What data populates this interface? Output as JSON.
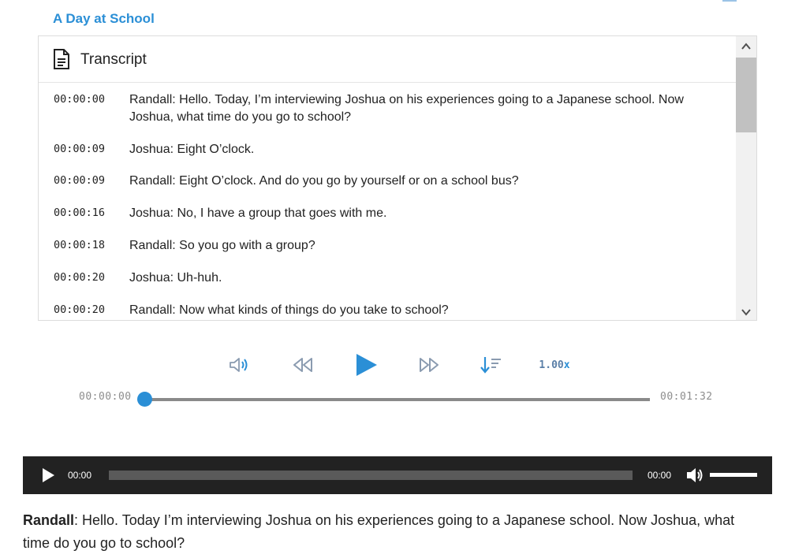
{
  "page": {
    "title": "A Day at School"
  },
  "transcript": {
    "header_label": "Transcript",
    "lines": [
      {
        "time": "00:00:00",
        "text": "Randall: Hello. Today, I’m interviewing Joshua on his experiences going to a Japanese school. Now Joshua, what time do you go to school?"
      },
      {
        "time": "00:00:09",
        "text": "Joshua: Eight O’clock."
      },
      {
        "time": "00:00:09",
        "text": "Randall: Eight O’clock. And do you go by yourself or on a school bus?"
      },
      {
        "time": "00:00:16",
        "text": "Joshua: No, I have a group that goes with me."
      },
      {
        "time": "00:00:18",
        "text": "Randall: So you go with a group?"
      },
      {
        "time": "00:00:20",
        "text": "Joshua: Uh-huh."
      },
      {
        "time": "00:00:20",
        "text": "Randall: Now what kinds of things do you take to school?"
      }
    ]
  },
  "controls": {
    "speed_value": "1.00",
    "speed_suffix": "x",
    "icons": [
      "volume-icon",
      "rewind-icon",
      "play-icon",
      "fast-forward-icon",
      "sort-icon"
    ],
    "accent_color": "#2b8fd6",
    "icon_color": "#8a9bb0"
  },
  "progress": {
    "current_time": "00:00:00",
    "total_time": "00:01:32",
    "fraction": 0.0
  },
  "audio_player": {
    "current_time": "00:00",
    "duration": "00:00",
    "volume_fraction": 1.0
  },
  "body_text": {
    "speaker": "Randall",
    "text": ": Hello. Today I’m interviewing Joshua on his experiences going to a Japanese school. Now Joshua, what time do you go to school?"
  }
}
